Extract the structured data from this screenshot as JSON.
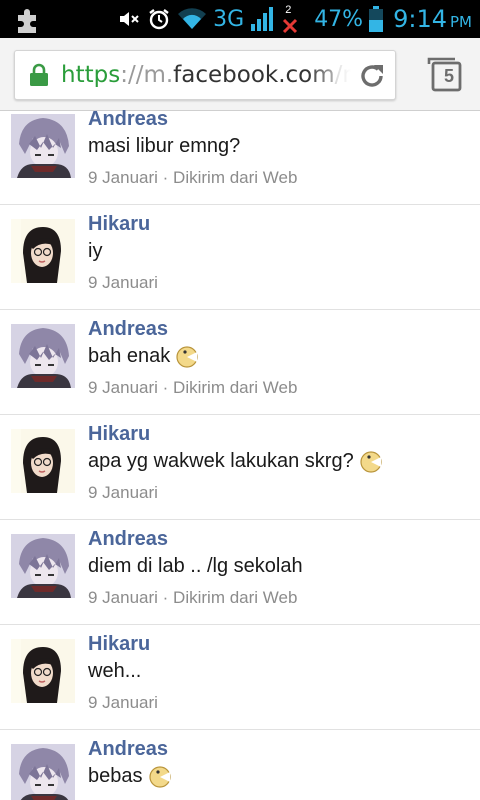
{
  "status_bar": {
    "network": "3G",
    "notification_count": "2",
    "battery": "47%",
    "time": "9:14",
    "ampm": "PM"
  },
  "browser": {
    "url_scheme": "https",
    "url_sep": "://",
    "url_host_prefix": "m.",
    "url_host": "facebook.com",
    "url_path": "/messages",
    "tab_count": "5"
  },
  "messages": [
    {
      "sender": "Andreas",
      "text": "masi libur emng?",
      "date": "9 Januari",
      "source": " · Dikirim dari Web",
      "emoticon": ""
    },
    {
      "sender": "Hikaru",
      "text": "iy",
      "date": "9 Januari",
      "source": "",
      "emoticon": ""
    },
    {
      "sender": "Andreas",
      "text": "bah enak",
      "date": "9 Januari",
      "source": " · Dikirim dari Web",
      "emoticon": "pacman-emoticon"
    },
    {
      "sender": "Hikaru",
      "text": "apa yg wakwek lakukan skrg?",
      "date": "9 Januari",
      "source": "",
      "emoticon": "pacman-emoticon"
    },
    {
      "sender": "Andreas",
      "text": "diem di lab .. /lg sekolah",
      "date": "9 Januari",
      "source": " · Dikirim dari Web",
      "emoticon": ""
    },
    {
      "sender": "Hikaru",
      "text": "weh...",
      "date": "9 Januari",
      "source": "",
      "emoticon": ""
    },
    {
      "sender": "Andreas",
      "text": "bebas",
      "date": "",
      "source": "",
      "emoticon": "pacman-emoticon"
    }
  ],
  "colors": {
    "sender_name": "#4b669a",
    "status_accent": "#33b5e5",
    "secure_green": "#2a9d3a"
  }
}
